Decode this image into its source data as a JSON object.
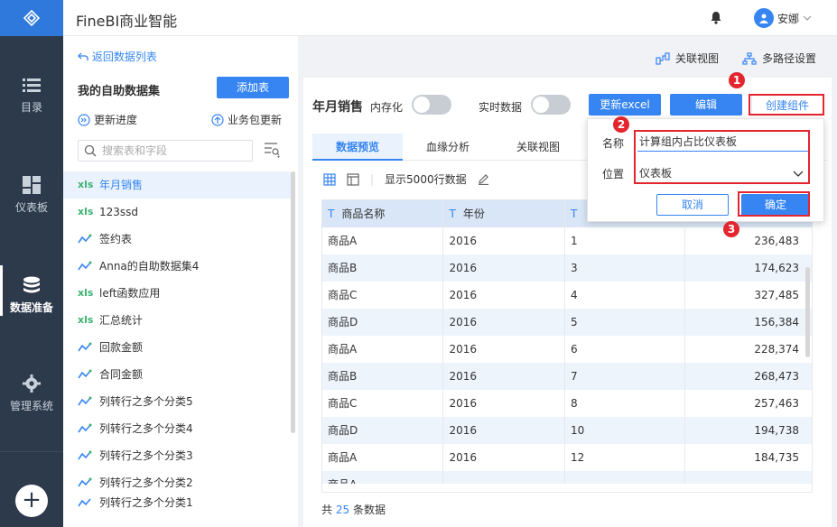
{
  "app": {
    "title": "FineBI商业智能",
    "user": "安娜"
  },
  "nav": [
    {
      "label": "目录",
      "icon": "list-icon"
    },
    {
      "label": "仪表板",
      "icon": "dashboard-icon"
    },
    {
      "label": "数据准备",
      "icon": "database-icon"
    },
    {
      "label": "管理系统",
      "icon": "gear-icon"
    }
  ],
  "left": {
    "back": "返回数据列表",
    "title": "我的自助数据集",
    "add_table": "添加表",
    "update_progress": "更新进度",
    "package_update": "业务包更新",
    "search_placeholder": "搜索表和字段",
    "items": [
      {
        "type": "xls",
        "name": "年月销售"
      },
      {
        "type": "xls",
        "name": "123ssd"
      },
      {
        "type": "self",
        "name": "签约表"
      },
      {
        "type": "self",
        "name": "Anna的自助数据集4"
      },
      {
        "type": "xls",
        "name": "left函数应用"
      },
      {
        "type": "xls",
        "name": "汇总统计"
      },
      {
        "type": "self",
        "name": "回款金额"
      },
      {
        "type": "self",
        "name": "合同金额"
      },
      {
        "type": "self",
        "name": "列转行之多个分类5"
      },
      {
        "type": "self",
        "name": "列转行之多个分类4"
      },
      {
        "type": "self",
        "name": "列转行之多个分类3"
      },
      {
        "type": "self",
        "name": "列转行之多个分类2"
      },
      {
        "type": "self",
        "name": "列转行之多个分类1"
      }
    ]
  },
  "right": {
    "link_view": "关联视图",
    "multipath": "多路径设置",
    "table_title": "年月销售",
    "in_memory": "内存化",
    "realtime": "实时数据",
    "update_excel": "更新excel",
    "edit": "编辑",
    "create_component": "创建组件",
    "tabs": [
      "数据预览",
      "血缘分析",
      "关联视图"
    ],
    "show_rows": "显示5000行数据",
    "columns": [
      "商品名称",
      "年份",
      ""
    ],
    "rows": [
      [
        "商品A",
        "2016",
        "1",
        "236,483"
      ],
      [
        "商品B",
        "2016",
        "3",
        "174,623"
      ],
      [
        "商品C",
        "2016",
        "4",
        "327,485"
      ],
      [
        "商品D",
        "2016",
        "5",
        "156,384"
      ],
      [
        "商品A",
        "2016",
        "6",
        "228,374"
      ],
      [
        "商品B",
        "2016",
        "7",
        "268,473"
      ],
      [
        "商品C",
        "2016",
        "8",
        "257,463"
      ],
      [
        "商品D",
        "2016",
        "10",
        "194,738"
      ],
      [
        "商品A",
        "2016",
        "12",
        "184,735"
      ],
      [
        "商品A",
        "",
        "",
        ""
      ]
    ],
    "count_prefix": "共",
    "count": "25",
    "count_suffix": "条数据"
  },
  "popup": {
    "name_label": "名称",
    "name_value": "计算组内占比仪表板",
    "position_label": "位置",
    "position_value": "仪表板",
    "cancel": "取消",
    "ok": "确定"
  },
  "markers": [
    "1",
    "2",
    "3"
  ]
}
